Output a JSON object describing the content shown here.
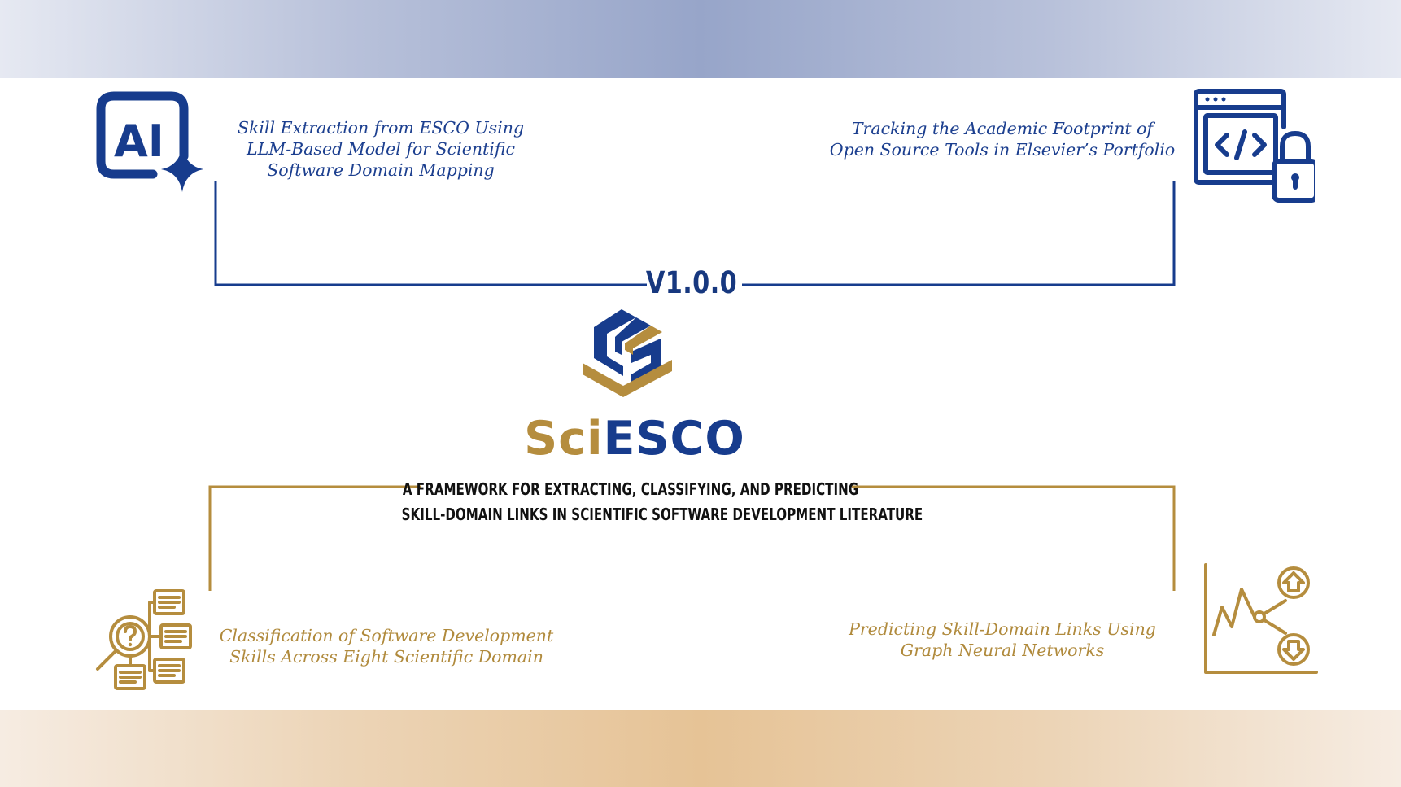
{
  "colors": {
    "navy": "#173c8d",
    "gold": "#b58d3e",
    "dark_text": "#111111"
  },
  "version": "V1.0.0",
  "logo": {
    "wordmark_part1": "Sci",
    "wordmark_part2": "ESCO"
  },
  "tagline": {
    "line1": "A FRAMEWORK FOR EXTRACTING, CLASSIFYING, AND PREDICTING",
    "line2": "SKILL-DOMAIN LINKS IN SCIENTIFIC SOFTWARE DEVELOPMENT LITERATURE"
  },
  "topics": {
    "top_left": {
      "icon": "ai-sparkle-icon",
      "lines": [
        "Skill Extraction from ESCO Using",
        "LLM-Based Model for Scientific",
        "Software Domain Mapping"
      ]
    },
    "top_right": {
      "icon": "code-window-lock-icon",
      "lines": [
        "Tracking the Academic Footprint of",
        "Open Source Tools in Elsevier’s Portfolio"
      ]
    },
    "bottom_left": {
      "icon": "search-hierarchy-icon",
      "lines": [
        "Classification of Software Development",
        "Skills Across Eight Scientific Domain"
      ]
    },
    "bottom_right": {
      "icon": "trend-up-down-icon",
      "lines": [
        "Predicting Skill-Domain Links Using",
        "Graph Neural Networks"
      ]
    },
    "ai_icon_text": "AI"
  }
}
